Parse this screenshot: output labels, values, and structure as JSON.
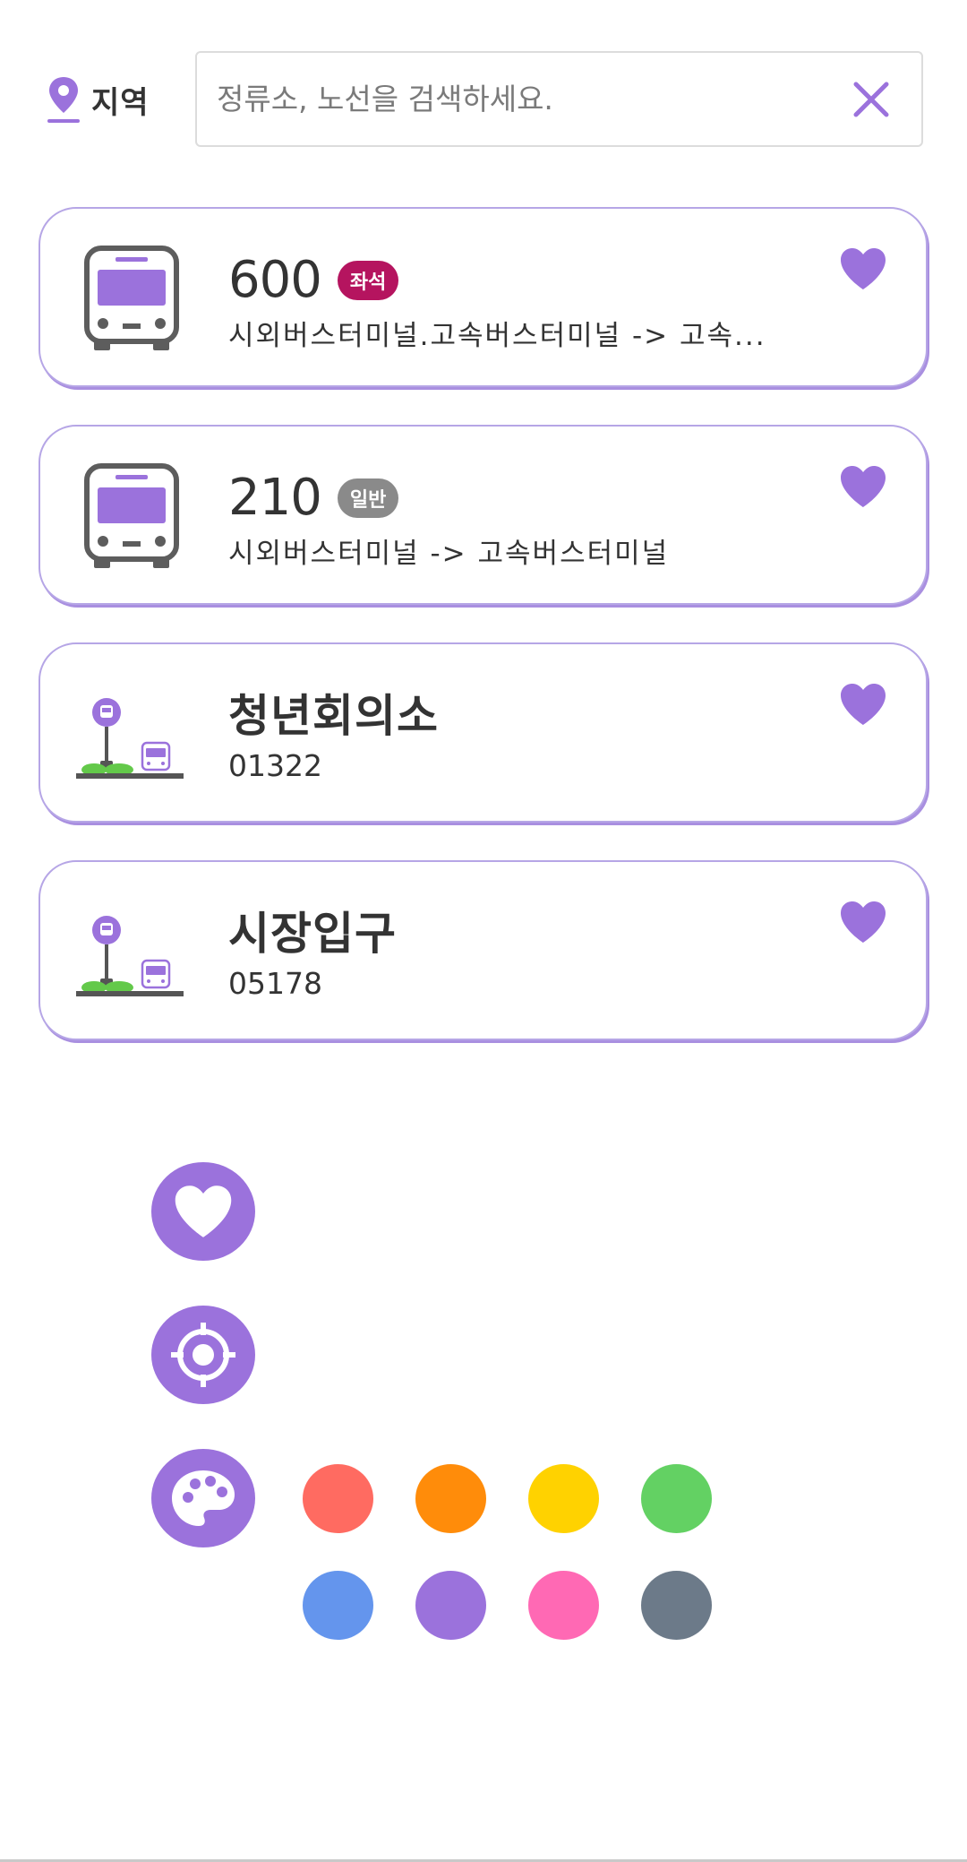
{
  "header": {
    "region_label": "지역",
    "search_placeholder": "정류소, 노선을 검색하세요."
  },
  "cards": [
    {
      "kind": "route",
      "number": "600",
      "badge": "좌석",
      "badge_color": "#b5145f",
      "description": "시외버스터미널.고속버스터미널 -> 고속..."
    },
    {
      "kind": "route",
      "number": "210",
      "badge": "일반",
      "badge_color": "#8a8a8a",
      "description": "시외버스터미널 -> 고속버스터미널"
    },
    {
      "kind": "stop",
      "name": "청년회의소",
      "id": "01322"
    },
    {
      "kind": "stop",
      "name": "시장입구",
      "id": "05178"
    }
  ],
  "theme": {
    "accent": "#9b72dc",
    "swatches": [
      "#ff6b61",
      "#ff8c0a",
      "#ffd200",
      "#63d163",
      "#6495ed",
      "#9b72dc",
      "#ff69b4",
      "#6c7a89"
    ]
  },
  "icons": {
    "region": "location-pin-icon",
    "clear": "close-icon",
    "favorite": "heart-icon",
    "locate": "crosshair-icon",
    "palette": "palette-icon",
    "bus": "bus-icon",
    "bus_stop": "bus-stop-icon"
  }
}
